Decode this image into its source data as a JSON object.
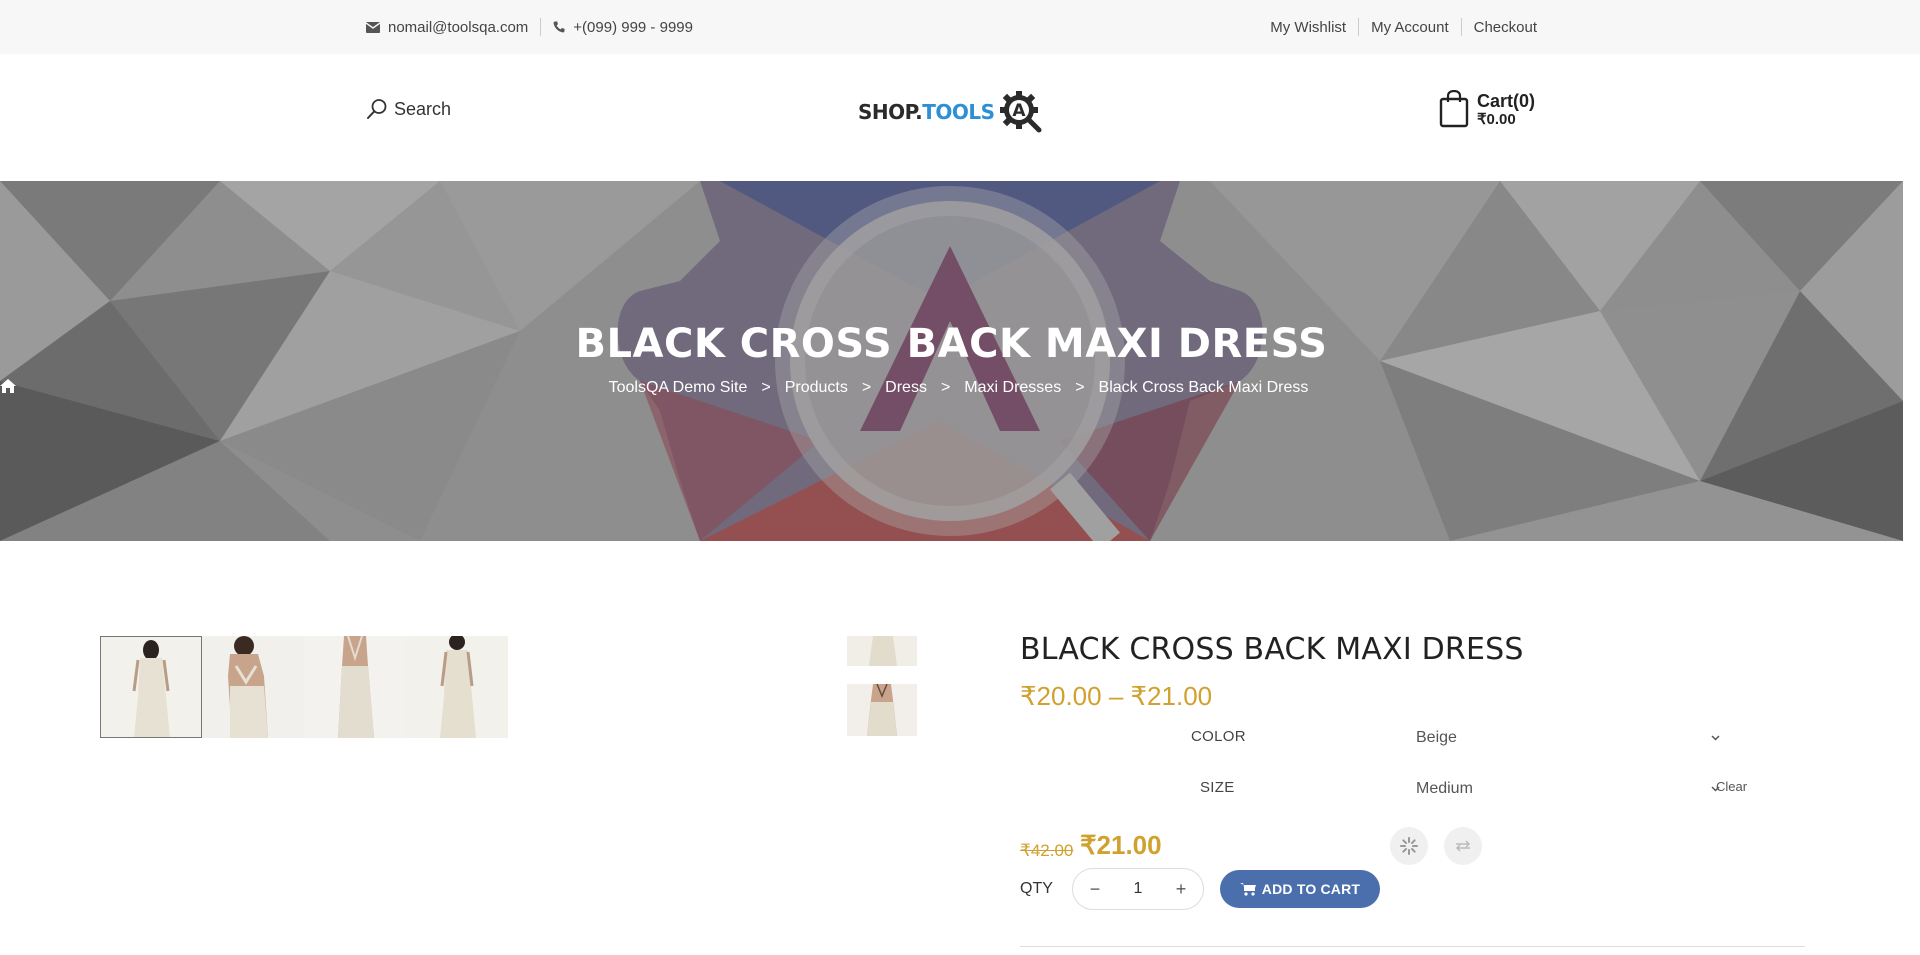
{
  "topbar": {
    "email": "nomail@toolsqa.com",
    "phone": "+(099) 999 - 9999",
    "links": [
      "My Wishlist",
      "My Account",
      "Checkout"
    ]
  },
  "header": {
    "search_label": "Search",
    "logo": {
      "shop": "SHOP.",
      "tools": "TOOLS",
      "badge": "A"
    },
    "cart_title": "Cart(0)",
    "cart_total": "₹0.00"
  },
  "hero": {
    "title": "BLACK CROSS BACK MAXI DRESS",
    "breadcrumb": [
      "ToolsQA Demo Site",
      "Products",
      "Dress",
      "Maxi Dresses",
      "Black Cross Back Maxi Dress"
    ],
    "separator": ">"
  },
  "product": {
    "title": "BLACK CROSS BACK MAXI DRESS",
    "price_range": "₹20.00 – ₹21.00",
    "variations": [
      {
        "label": "COLOR",
        "value": "Beige"
      },
      {
        "label": "SIZE",
        "value": "Medium"
      }
    ],
    "clear_label": "Clear",
    "old_price": "₹42.00",
    "new_price": "₹21.00",
    "qty_label": "QTY",
    "qty_value": "1",
    "qty_minus": "−",
    "qty_plus": "+",
    "add_to_cart_label": "ADD TO CART"
  },
  "colors": {
    "price": "#d0a12e",
    "button": "#4b6fad",
    "topbar_bg": "#f7f7f7",
    "logo_blue": "#2d8fd5"
  },
  "icons": [
    "envelope-icon",
    "phone-icon",
    "search-icon",
    "cart-bag-icon",
    "home-icon",
    "cart-icon",
    "wishlist-loading-icon",
    "compare-icon",
    "chevron-down-icon"
  ]
}
